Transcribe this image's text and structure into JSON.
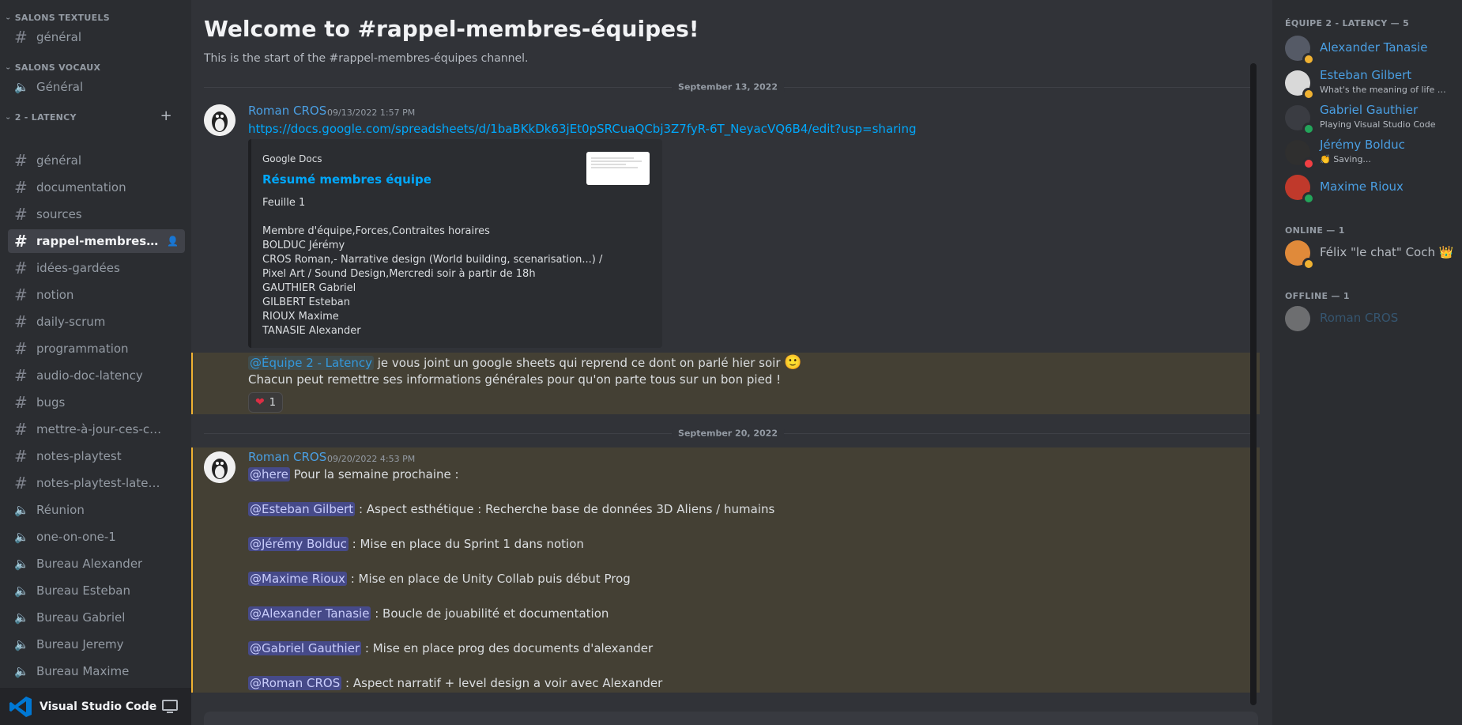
{
  "sidebar": {
    "cat_text": "SALONS TEXTUELS",
    "text_channels": [
      "général"
    ],
    "cat_voice": "SALONS VOCAUX",
    "voice_channels": [
      "Général"
    ],
    "cat_latency": "2 - LATENCY",
    "latency_channels": [
      {
        "name": "général",
        "type": "text"
      },
      {
        "name": "documentation",
        "type": "text"
      },
      {
        "name": "sources",
        "type": "text"
      },
      {
        "name": "rappel-membres-équ...",
        "type": "text",
        "active": true
      },
      {
        "name": "idées-gardées",
        "type": "text"
      },
      {
        "name": "notion",
        "type": "text"
      },
      {
        "name": "daily-scrum",
        "type": "text"
      },
      {
        "name": "programmation",
        "type": "text"
      },
      {
        "name": "audio-doc-latency",
        "type": "text"
      },
      {
        "name": "bugs",
        "type": "text"
      },
      {
        "name": "mettre-à-jour-ces-contr...",
        "type": "text"
      },
      {
        "name": "notes-playtest",
        "type": "text"
      },
      {
        "name": "notes-playtest-latency",
        "type": "text"
      },
      {
        "name": "Réunion",
        "type": "voice"
      },
      {
        "name": "one-on-one-1",
        "type": "voice"
      },
      {
        "name": "Bureau Alexander",
        "type": "voice"
      },
      {
        "name": "Bureau Esteban",
        "type": "voice"
      },
      {
        "name": "Bureau Gabriel",
        "type": "voice"
      },
      {
        "name": "Bureau Jeremy",
        "type": "voice"
      },
      {
        "name": "Bureau Maxime",
        "type": "voice"
      }
    ],
    "app_title": "Visual Studio Code"
  },
  "chat": {
    "welcome_title": "Welcome to #rappel-membres-équipes!",
    "welcome_sub": "This is the start of the #rappel-membres-équipes channel.",
    "date1": "September 13, 2022",
    "msg1": {
      "author": "Roman CROS",
      "time": "09/13/2022 1:57 PM",
      "link": "https://docs.google.com/spreadsheets/d/1baBKkDk63jEt0pSRCuaQCbj3Z7fyR-6T_NeyacVQ6B4/edit?usp=sharing",
      "embed_provider": "Google Docs",
      "embed_title": "Résumé membres équipe",
      "embed_desc": "Feuille 1\n\nMembre d'équipe,Forces,Contraites horaires\nBOLDUC Jérémy\nCROS Roman,- Narrative design (World building, scenarisation...) /\nPixel Art / Sound Design,Mercredi soir à partir de 18h\nGAUTHIER Gabriel\nGILBERT Esteban\nRIOUX Maxime\nTANASIE Alexander",
      "role_mention": "@Équipe 2 - Latency",
      "text1": "je vous joint un google sheets qui reprend ce dont on parlé hier soir",
      "emoji": "🙂",
      "text2": "Chacun peut remettre ses informations générales pour qu'on parte tous sur un bon pied !",
      "reaction_count": "1"
    },
    "date2": "September 20, 2022",
    "msg2": {
      "author": "Roman CROS",
      "time": "09/20/2022 4:53 PM",
      "here": "@here",
      "intro": "Pour la semaine prochaine :",
      "items": [
        {
          "mention": "@Esteban Gilbert",
          "text": ": Aspect esthétique : Recherche base de données 3D Aliens / humains"
        },
        {
          "mention": "@Jérémy Bolduc",
          "text": ": Mise en place du Sprint 1 dans notion"
        },
        {
          "mention": "@Maxime Rioux",
          "text": ": Mise en place de Unity Collab puis début Prog"
        },
        {
          "mention": "@Alexander Tanasie",
          "text": ": Boucle de jouabilité et documentation"
        },
        {
          "mention": "@Gabriel Gauthier",
          "text": ": Mise en place prog des documents d'alexander"
        },
        {
          "mention": "@Roman CROS",
          "text": ": Aspect narratif + level design a voir avec Alexander"
        }
      ]
    }
  },
  "members": {
    "cat_team": "ÉQUIPE 2 - LATENCY — 5",
    "team": [
      {
        "name": "Alexander Tanasie",
        "status": "",
        "dot": "idle"
      },
      {
        "name": "Esteban Gilbert",
        "status": "What's the meaning of life if I ...",
        "dot": "idle"
      },
      {
        "name": "Gabriel Gauthier",
        "status": "Playing Visual Studio Code",
        "dot": "green"
      },
      {
        "name": "Jérémy Bolduc",
        "status": "👏 Saving...",
        "dot": "dnd"
      },
      {
        "name": "Maxime Rioux",
        "status": "",
        "dot": "green"
      }
    ],
    "cat_online": "ONLINE — 1",
    "online": [
      {
        "name": "Félix \"le chat\" Coch",
        "crown": "👑",
        "dot": "idle"
      }
    ],
    "cat_offline": "OFFLINE — 1",
    "offline": [
      {
        "name": "Roman CROS"
      }
    ]
  },
  "colors": {
    "accent": "#4a9fe3",
    "link": "#00a8fc",
    "highlight": "#444034",
    "highlight_border": "#f0b232"
  }
}
